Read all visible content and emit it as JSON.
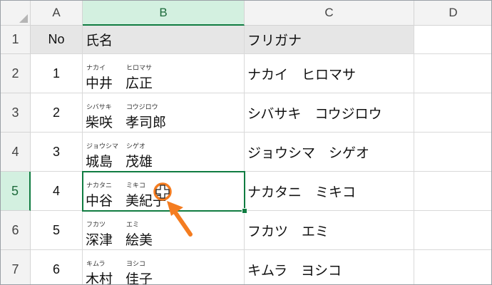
{
  "columns": [
    "A",
    "B",
    "C",
    "D"
  ],
  "rows": [
    "1",
    "2",
    "3",
    "4",
    "5",
    "6",
    "7"
  ],
  "header_row": {
    "a": "No",
    "b": "氏名",
    "c": "フリガナ"
  },
  "records": [
    {
      "no": "1",
      "surname": "中井",
      "given": "広正",
      "surname_furi": "ナカイ",
      "given_furi": "ヒロマサ",
      "furigana": "ナカイ　ヒロマサ"
    },
    {
      "no": "2",
      "surname": "柴咲",
      "given": "孝司郎",
      "surname_furi": "シバサキ",
      "given_furi": "コウジロウ",
      "furigana": "シバサキ　コウジロウ"
    },
    {
      "no": "3",
      "surname": "城島",
      "given": "茂雄",
      "surname_furi": "ジョウシマ",
      "given_furi": "シゲオ",
      "furigana": "ジョウシマ　シゲオ"
    },
    {
      "no": "4",
      "surname": "中谷",
      "given": "美紀子",
      "surname_furi": "ナカタニ",
      "given_furi": "ミキコ",
      "furigana": "ナカタニ　ミキコ"
    },
    {
      "no": "5",
      "surname": "深津",
      "given": "絵美",
      "surname_furi": "フカツ",
      "given_furi": "エミ",
      "furigana": "フカツ　エミ"
    },
    {
      "no": "6",
      "surname": "木村",
      "given": "佳子",
      "surname_furi": "キムラ",
      "given_furi": "ヨシコ",
      "furigana": "キムラ　ヨシコ"
    }
  ],
  "selected_cell": "B5",
  "colors": {
    "accent": "#107c41",
    "annotation": "#f47c20"
  },
  "icons": {
    "cursor": "fill-cross-cursor-icon",
    "arrow": "annotation-arrow-icon"
  }
}
